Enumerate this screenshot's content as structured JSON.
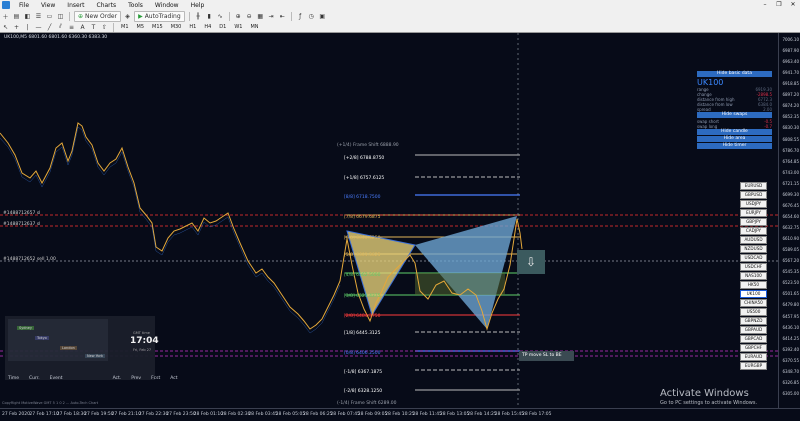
{
  "menu": {
    "items": [
      "File",
      "View",
      "Insert",
      "Charts",
      "Tools",
      "Window",
      "Help"
    ]
  },
  "toolbar": {
    "new_order": "New Order",
    "autotrading": "AutoTrading"
  },
  "timeframes": [
    "M1",
    "M5",
    "M15",
    "M30",
    "H1",
    "H4",
    "D1",
    "W1",
    "MN"
  ],
  "symbol_info": "UK100,M5  6801.60 6801.60 6360.30 6383.30",
  "levels": [
    {
      "label": "(+1/4) Frame Shift  6888.90",
      "color": "gray"
    },
    {
      "label": "[+2/8]  6788.8750",
      "color": "white"
    },
    {
      "label": "[+1/8]  6757.6125",
      "color": "white"
    },
    {
      "label": "[8/8]  6718.7500",
      "color": "blue"
    },
    {
      "label": "[7/8]  6679.6875",
      "color": "gold"
    },
    {
      "label": "[6/8]  6640.6250",
      "color": "gold"
    },
    {
      "label": "[5/8]  6601.5625",
      "color": "gold"
    },
    {
      "label": "[4/8]  6562.5000",
      "color": "green"
    },
    {
      "label": "[3/8]  6523.4375",
      "color": "green"
    },
    {
      "label": "[2/8]  6484.3750",
      "color": "red"
    },
    {
      "label": "[1/8]  6445.3125",
      "color": "white"
    },
    {
      "label": "[0/8]  6406.2500",
      "color": "blue"
    },
    {
      "label": "[-1/8]  6367.1875",
      "color": "white"
    },
    {
      "label": "[-2/8]  6328.1250",
      "color": "white"
    },
    {
      "label": "(-1/4) Frame Shift  6289.00",
      "color": "gray"
    }
  ],
  "hlines": [
    {
      "label": "#1488712657 sl"
    },
    {
      "label": "#1488712637 sl"
    },
    {
      "label": "#1488712652 sell 1.00"
    }
  ],
  "tp": {
    "label": "TP move SL to BE",
    "value": "TP - 6465.12"
  },
  "panel": {
    "hide_basic": "Hide basic data",
    "symbol": "UK100",
    "rows": [
      {
        "k": "range",
        "v": "6919.30"
      },
      {
        "k": "change",
        "v": "-2898.5",
        "neg": true
      },
      {
        "k": "distance from high",
        "v": "6772.3"
      },
      {
        "k": "distance from low",
        "v": "6384.0"
      },
      {
        "k": "spread",
        "v": "2.00"
      }
    ],
    "hide_swaps": "Hide swaps",
    "swaps": [
      {
        "k": "swap short",
        "v": "-0.5"
      },
      {
        "k": "swap long",
        "v": "-0.7"
      }
    ],
    "hide_candle": "Hide candle",
    "hide_area": "Hide area",
    "hide_timer": "Hide timer"
  },
  "symbols": [
    "EURUSD",
    "GBPUSD",
    "USDJPY",
    "EURJPY",
    "GBPJPY",
    "CADJPY",
    "AUDUSD",
    "NZDUSD",
    "USDCAD",
    "USDCHF",
    "NAS100",
    "HK50",
    "UK100",
    "CHINA50",
    "US500",
    "GBPNZD",
    "GBPAUD",
    "GBPCAD",
    "GBPCHF",
    "EURAUD",
    "EURGBP"
  ],
  "active_symbol": "UK100",
  "clock": {
    "time": "17:04",
    "tz": "GMT time",
    "date": "Fri, Feb 27",
    "sessions": [
      "Sydney",
      "Tokyo",
      "London",
      "New York"
    ]
  },
  "news_bar": [
    "Time",
    "Curr.",
    "Event",
    "Act.",
    "Prev",
    "Fcst",
    "Act"
  ],
  "watermark": {
    "line1": "Activate Windows",
    "line2": "Go to PC settings to activate Windows."
  },
  "time_labels": [
    "27 Feb 2020",
    "27 Feb 17:10",
    "27 Feb 18:30",
    "27 Feb 19:50",
    "27 Feb 21:10",
    "27 Feb 22:30",
    "27 Feb 23:50",
    "28 Feb 01:10",
    "28 Feb 02:30",
    "28 Feb 03:45",
    "28 Feb 05:05",
    "28 Feb 06:25",
    "28 Feb 07:45",
    "28 Feb 09:05",
    "28 Feb 10:25",
    "28 Feb 11:45",
    "28 Feb 13:05",
    "28 Feb 14:25",
    "28 Feb 15:45",
    "28 Feb 17:05"
  ],
  "price_labels": [
    "7006.10",
    "6987.90",
    "6963.40",
    "6941.70",
    "6918.85",
    "6897.20",
    "6874.20",
    "6852.35",
    "6830.30",
    "6808.55",
    "6786.70",
    "6764.85",
    "6743.00",
    "6721.15",
    "6699.30",
    "6676.45",
    "6654.60",
    "6632.75",
    "6610.90",
    "6589.05",
    "6567.20",
    "6545.35",
    "6523.50",
    "6501.65",
    "6479.80",
    "6457.95",
    "6436.10",
    "6414.25",
    "6392.40",
    "6370.55",
    "6348.70",
    "6326.85",
    "6305.00"
  ],
  "status_text": "CopyRight MotiveWave  GMT 5 1 0 2 ... Auto-Tech Chart"
}
